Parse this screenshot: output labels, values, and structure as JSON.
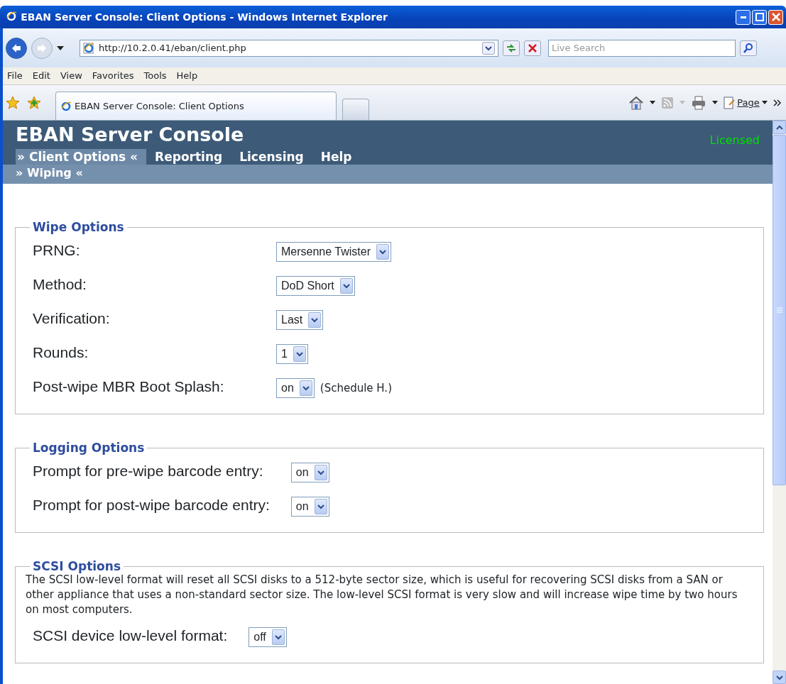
{
  "window": {
    "title": "EBAN Server Console: Client Options - Windows Internet Explorer"
  },
  "address_bar": {
    "url": "http://10.2.0.41/eban/client.php",
    "search_placeholder": "Live Search"
  },
  "menu": [
    "File",
    "Edit",
    "View",
    "Favorites",
    "Tools",
    "Help"
  ],
  "tabs": [
    {
      "label": "EBAN Server Console: Client Options",
      "selected": true
    }
  ],
  "command_bar": {
    "page_label": "Page"
  },
  "page": {
    "title": "EBAN Server Console",
    "status": "Licensed",
    "nav": [
      {
        "label": "» Client Options «",
        "selected": true
      },
      {
        "label": "Reporting",
        "selected": false
      },
      {
        "label": "Licensing",
        "selected": false
      },
      {
        "label": "Help",
        "selected": false
      }
    ],
    "subnav": [
      {
        "label": "» Wiping «",
        "selected": true
      }
    ],
    "sections": [
      {
        "legend": "Wipe Options",
        "rows": [
          {
            "label": "PRNG:",
            "value": "Mersenne Twister"
          },
          {
            "label": "Method:",
            "value": "DoD Short"
          },
          {
            "label": "Verification:",
            "value": "Last"
          },
          {
            "label": "Rounds:",
            "value": "1"
          },
          {
            "label": "Post-wipe MBR Boot Splash:",
            "value": "on",
            "note": "(Schedule H.)"
          }
        ]
      },
      {
        "legend": "Logging Options",
        "rows": [
          {
            "label": "Prompt for pre-wipe barcode entry:",
            "value": "on"
          },
          {
            "label": "Prompt for post-wipe barcode entry:",
            "value": "on"
          }
        ]
      },
      {
        "legend": "SCSI Options",
        "description": "The SCSI low-level format will reset all SCSI disks to a 512-byte sector size, which is useful for recovering SCSI disks from a SAN or other appliance that uses a non-standard sector size. The low-level SCSI format is very slow and will increase wipe time by two hours on most computers.",
        "rows": [
          {
            "label": "SCSI device low-level format:",
            "value": "off"
          }
        ]
      }
    ]
  }
}
